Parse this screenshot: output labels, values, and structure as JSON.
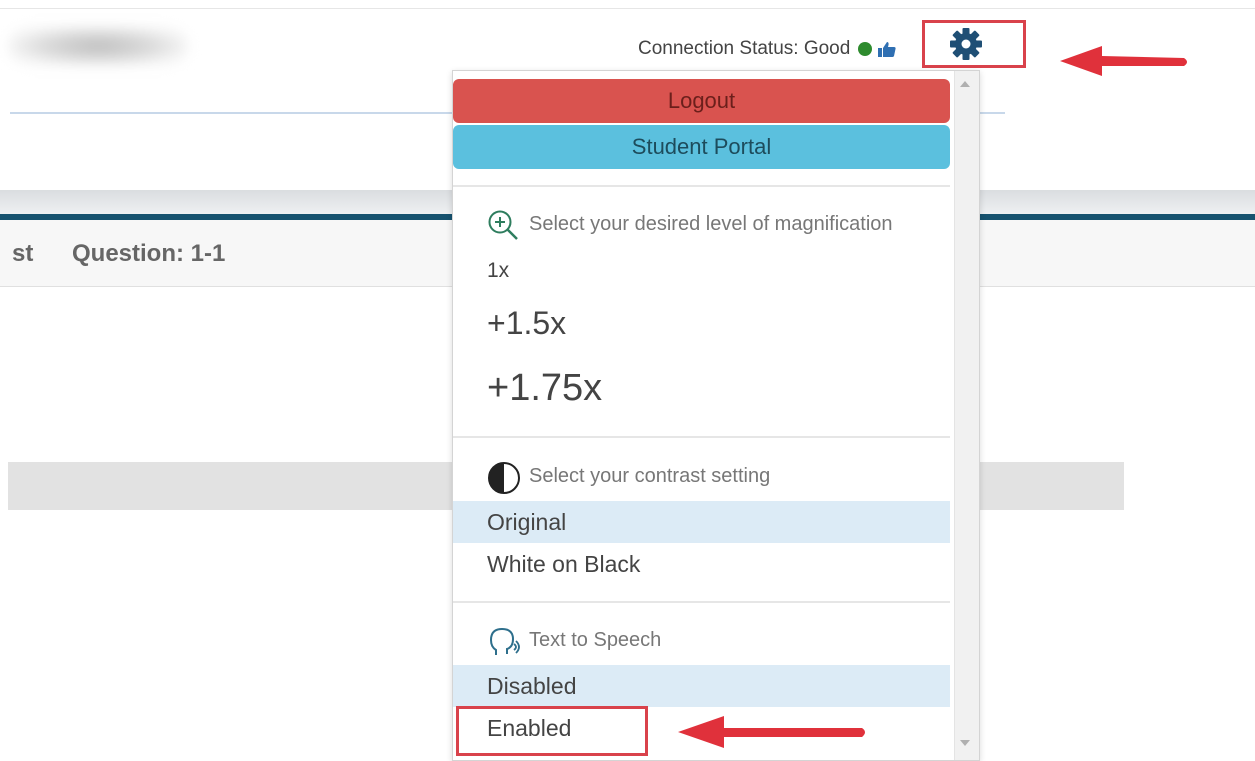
{
  "header": {
    "connection_label": "Connection Status: Good",
    "connection_color": "#2e8b2e",
    "settings_icon": "gear-icon",
    "settings_color": "#1f4f75"
  },
  "question_bar": {
    "partial_text": "st",
    "question_label": "Question: 1-1"
  },
  "menu": {
    "logout_label": "Logout",
    "logout_color": "#d9534f",
    "portal_label": "Student Portal",
    "portal_color": "#5bc0de",
    "magnification": {
      "icon": "zoom-in-icon",
      "heading": "Select your desired level of magnification",
      "options": [
        "1x",
        "+1.5x",
        "+1.75x"
      ]
    },
    "contrast": {
      "icon": "contrast-icon",
      "heading": "Select your contrast setting",
      "options": [
        "Original",
        "White on Black"
      ],
      "selected": "Original"
    },
    "tts": {
      "icon": "speaking-head-icon",
      "heading": "Text to Speech",
      "options": [
        "Disabled",
        "Enabled"
      ],
      "selected": "Disabled"
    }
  },
  "annotations": {
    "highlight_color": "#d9424b",
    "arrow_color": "#e0313b"
  }
}
